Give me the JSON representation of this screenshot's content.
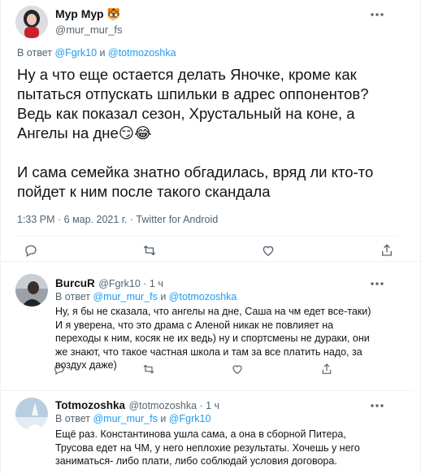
{
  "main_tweet": {
    "author_name": "Мур Мур 🐯",
    "author_handle": "@mur_mur_fs",
    "reply_prefix": "В ответ",
    "reply_to_1": "@Fgrk10",
    "reply_join": "и",
    "reply_to_2": "@totmozoshka",
    "text": "Ну а что еще остается делать Яночке, кроме как пытаться отпускать шпильки в адрес оппонентов? Ведь как показал сезон, Хрустальный на коне, а Ангелы на дне😏😂\n\nИ сама семейка знатно обгадилась, вряд ли кто-то пойдет к ним после такого скандала",
    "timestamp": "1:33 PM · 6 мар. 2021 г. · Twitter for Android"
  },
  "replies": [
    {
      "author_name": "BurcuR",
      "author_handle": "@Fgrk10 · 1 ч",
      "reply_prefix": "В ответ",
      "reply_to_1": "@mur_mur_fs",
      "reply_join": "и",
      "reply_to_2": "@totmozoshka",
      "text": "Ну, я бы не сказала, что ангелы на дне, Саша на чм едет все-таки)\nИ я уверена, что это драма с Аленой никак не повлияет на переходы к ним, косяк не их ведь) ну и спортсмены не дураки, они же знают, что такое частная школа и там за все платить надо, за воздух даже)"
    },
    {
      "author_name": "Totmozoshka",
      "author_handle": "@totmozoshka · 1 ч",
      "reply_prefix": "В ответ",
      "reply_to_1": "@mur_mur_fs",
      "reply_join": "и",
      "reply_to_2": "@Fgrk10",
      "text": "Ещё раз. Константинова ушла сама, а она в сборной Питера, Трусова едет на ЧМ, у него неплохие результаты. Хочешь у него заниматься- либо плати, либо соблюдай условия договора."
    }
  ],
  "icons": {
    "more": "more-icon",
    "reply": "reply-icon",
    "retweet": "retweet-icon",
    "like": "like-icon",
    "share": "share-icon"
  },
  "colors": {
    "accent": "#1d9bf0",
    "secondary_text": "#536471",
    "divider": "#eff3f4"
  }
}
